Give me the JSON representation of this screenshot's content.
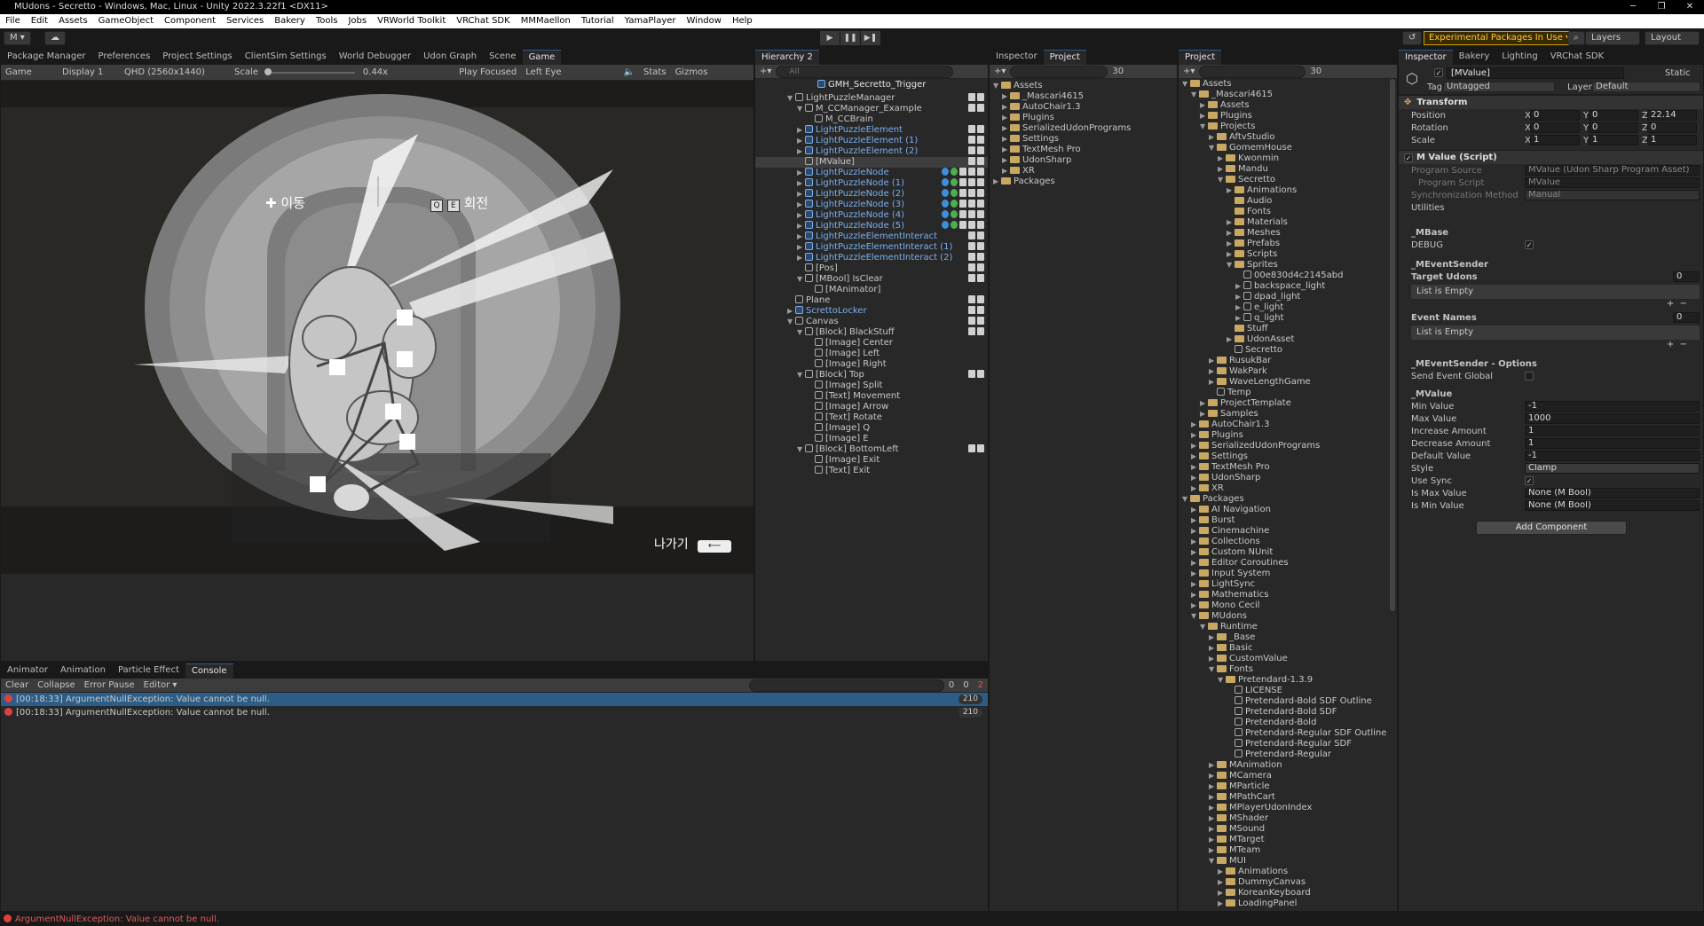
{
  "title": "MUdons - Secretto - Windows, Mac, Linux - Unity 2022.3.22f1 <DX11>",
  "menu": [
    "File",
    "Edit",
    "Assets",
    "GameObject",
    "Component",
    "Services",
    "Bakery",
    "Tools",
    "Jobs",
    "VRWorld Toolkit",
    "VRChat SDK",
    "MMMaellon",
    "Tutorial",
    "YamaPlayer",
    "Window",
    "Help"
  ],
  "toolbar": {
    "account": "M ▾",
    "experimental": "Experimental Packages In Use ▾",
    "layers": "Layers",
    "layout": "Layout"
  },
  "left_tabs": [
    "Package Manager",
    "Preferences",
    "Project Settings",
    "ClientSim Settings",
    "World Debugger",
    "Udon Graph",
    "Scene",
    "Game"
  ],
  "game_bar": {
    "mode": "Game",
    "display": "Display 1",
    "resolution": "QHD (2560x1440)",
    "scale_label": "Scale",
    "scale_value": "0.44x",
    "play_focused": "Play Focused",
    "eye": "Left Eye",
    "stats": "Stats",
    "gizmos": "Gizmos"
  },
  "game_ui": {
    "move_key": "✚",
    "move_label": "이동",
    "q": "Q",
    "e": "E",
    "rotate_label": "회전",
    "exit_label": "나가기",
    "exit_key": "⟵"
  },
  "hierarchy": {
    "tab": "Hierarchy 2",
    "search": "All",
    "scene": "GMH_Secretto_Trigger",
    "items": [
      {
        "d": 1,
        "t": "GMH_Secretto_Trigger",
        "b": false,
        "a": "▼",
        "s": false
      },
      {
        "d": 2,
        "t": "LightPuzzleManager",
        "b": false,
        "a": "▼",
        "s": false
      },
      {
        "d": 3,
        "t": "M_CCManager_Example",
        "b": false,
        "a": "▼",
        "s": false
      },
      {
        "d": 4,
        "t": "M_CCBrain",
        "b": false,
        "a": "",
        "s": false
      },
      {
        "d": 3,
        "t": "LightPuzzleElement",
        "b": true,
        "a": "▶",
        "s": false
      },
      {
        "d": 3,
        "t": "LightPuzzleElement (1)",
        "b": true,
        "a": "▶",
        "s": false
      },
      {
        "d": 3,
        "t": "LightPuzzleElement (2)",
        "b": true,
        "a": "▶",
        "s": false
      },
      {
        "d": 3,
        "t": "[MValue]",
        "b": false,
        "a": "",
        "s": true
      },
      {
        "d": 3,
        "t": "LightPuzzleNode",
        "b": true,
        "a": "▶",
        "s": false
      },
      {
        "d": 3,
        "t": "LightPuzzleNode (1)",
        "b": true,
        "a": "▶",
        "s": false
      },
      {
        "d": 3,
        "t": "LightPuzzleNode (2)",
        "b": true,
        "a": "▶",
        "s": false
      },
      {
        "d": 3,
        "t": "LightPuzzleNode (3)",
        "b": true,
        "a": "▶",
        "s": false
      },
      {
        "d": 3,
        "t": "LightPuzzleNode (4)",
        "b": true,
        "a": "▶",
        "s": false
      },
      {
        "d": 3,
        "t": "LightPuzzleNode (5)",
        "b": true,
        "a": "▶",
        "s": false
      },
      {
        "d": 3,
        "t": "LightPuzzleElementInteract",
        "b": true,
        "a": "▶",
        "s": false
      },
      {
        "d": 3,
        "t": "LightPuzzleElementInteract (1)",
        "b": true,
        "a": "▶",
        "s": false
      },
      {
        "d": 3,
        "t": "LightPuzzleElementInteract (2)",
        "b": true,
        "a": "▶",
        "s": false
      },
      {
        "d": 3,
        "t": "[Pos]",
        "b": false,
        "a": "",
        "s": false
      },
      {
        "d": 3,
        "t": "[MBool] IsClear",
        "b": false,
        "a": "▼",
        "s": false
      },
      {
        "d": 4,
        "t": "[MAnimator]",
        "b": false,
        "a": "",
        "s": false
      },
      {
        "d": 2,
        "t": "Plane",
        "b": false,
        "a": "",
        "s": false
      },
      {
        "d": 2,
        "t": "ScrettoLocker",
        "b": true,
        "a": "▶",
        "s": false
      },
      {
        "d": 2,
        "t": "Canvas",
        "b": false,
        "a": "▼",
        "s": false
      },
      {
        "d": 3,
        "t": "[Block] BlackStuff",
        "b": false,
        "a": "▼",
        "s": false
      },
      {
        "d": 4,
        "t": "[Image] Center",
        "b": false,
        "a": "",
        "s": false
      },
      {
        "d": 4,
        "t": "[Image] Left",
        "b": false,
        "a": "",
        "s": false
      },
      {
        "d": 4,
        "t": "[Image] Right",
        "b": false,
        "a": "",
        "s": false
      },
      {
        "d": 3,
        "t": "[Block] Top",
        "b": false,
        "a": "▼",
        "s": false
      },
      {
        "d": 4,
        "t": "[Image] Split",
        "b": false,
        "a": "",
        "s": false
      },
      {
        "d": 4,
        "t": "[Text] Movement",
        "b": false,
        "a": "",
        "s": false
      },
      {
        "d": 4,
        "t": "[Image] Arrow",
        "b": false,
        "a": "",
        "s": false
      },
      {
        "d": 4,
        "t": "[Text] Rotate",
        "b": false,
        "a": "",
        "s": false
      },
      {
        "d": 4,
        "t": "[Image] Q",
        "b": false,
        "a": "",
        "s": false
      },
      {
        "d": 4,
        "t": "[Image] E",
        "b": false,
        "a": "",
        "s": false
      },
      {
        "d": 3,
        "t": "[Block] BottomLeft",
        "b": false,
        "a": "▼",
        "s": false
      },
      {
        "d": 4,
        "t": "[Image] Exit",
        "b": false,
        "a": "",
        "s": false
      },
      {
        "d": 4,
        "t": "[Text] Exit",
        "b": false,
        "a": "",
        "s": false
      }
    ]
  },
  "project_small": {
    "tabs": [
      "Inspector",
      "Project"
    ],
    "count": "30",
    "items": [
      {
        "d": 0,
        "t": "Assets",
        "a": "▼"
      },
      {
        "d": 1,
        "t": "_Mascari4615",
        "a": "▶"
      },
      {
        "d": 1,
        "t": "AutoChair1.3",
        "a": "▶"
      },
      {
        "d": 1,
        "t": "Plugins",
        "a": "▶"
      },
      {
        "d": 1,
        "t": "SerializedUdonPrograms",
        "a": "▶"
      },
      {
        "d": 1,
        "t": "Settings",
        "a": "▶"
      },
      {
        "d": 1,
        "t": "TextMesh Pro",
        "a": "▶"
      },
      {
        "d": 1,
        "t": "UdonSharp",
        "a": "▶"
      },
      {
        "d": 1,
        "t": "XR",
        "a": "▶"
      },
      {
        "d": 0,
        "t": "Packages",
        "a": "▶"
      }
    ]
  },
  "project": {
    "tab": "Project",
    "count": "30",
    "items": [
      {
        "d": 0,
        "t": "Assets",
        "a": "▼",
        "f": 1
      },
      {
        "d": 1,
        "t": "_Mascari4615",
        "a": "▼",
        "f": 1
      },
      {
        "d": 2,
        "t": "Assets",
        "a": "▶",
        "f": 1
      },
      {
        "d": 2,
        "t": "Plugins",
        "a": "▶",
        "f": 1
      },
      {
        "d": 2,
        "t": "Projects",
        "a": "▼",
        "f": 1
      },
      {
        "d": 3,
        "t": "AftvStudio",
        "a": "▶",
        "f": 1
      },
      {
        "d": 3,
        "t": "GomemHouse",
        "a": "▼",
        "f": 1
      },
      {
        "d": 4,
        "t": "Kwonmin",
        "a": "▶",
        "f": 1
      },
      {
        "d": 4,
        "t": "Mandu",
        "a": "▶",
        "f": 1
      },
      {
        "d": 4,
        "t": "Secretto",
        "a": "▼",
        "f": 1
      },
      {
        "d": 5,
        "t": "Animations",
        "a": "▶",
        "f": 1
      },
      {
        "d": 5,
        "t": "Audio",
        "a": "",
        "f": 1
      },
      {
        "d": 5,
        "t": "Fonts",
        "a": "",
        "f": 1
      },
      {
        "d": 5,
        "t": "Materials",
        "a": "▶",
        "f": 1
      },
      {
        "d": 5,
        "t": "Meshes",
        "a": "▶",
        "f": 1
      },
      {
        "d": 5,
        "t": "Prefabs",
        "a": "▶",
        "f": 1
      },
      {
        "d": 5,
        "t": "Scripts",
        "a": "▶",
        "f": 1
      },
      {
        "d": 5,
        "t": "Sprites",
        "a": "▼",
        "f": 1
      },
      {
        "d": 6,
        "t": "00e830d4c2145abd",
        "a": "",
        "f": 0
      },
      {
        "d": 6,
        "t": "backspace_light",
        "a": "▶",
        "f": 0
      },
      {
        "d": 6,
        "t": "dpad_light",
        "a": "▶",
        "f": 0
      },
      {
        "d": 6,
        "t": "e_light",
        "a": "▶",
        "f": 0
      },
      {
        "d": 6,
        "t": "q_light",
        "a": "▶",
        "f": 0
      },
      {
        "d": 5,
        "t": "Stuff",
        "a": "",
        "f": 1
      },
      {
        "d": 5,
        "t": "UdonAsset",
        "a": "▶",
        "f": 1
      },
      {
        "d": 5,
        "t": "Secretto",
        "a": "",
        "f": 0
      },
      {
        "d": 3,
        "t": "RusukBar",
        "a": "▶",
        "f": 1
      },
      {
        "d": 3,
        "t": "WakPark",
        "a": "▶",
        "f": 1
      },
      {
        "d": 3,
        "t": "WaveLengthGame",
        "a": "▶",
        "f": 1
      },
      {
        "d": 3,
        "t": "Temp",
        "a": "",
        "f": 0
      },
      {
        "d": 2,
        "t": "ProjectTemplate",
        "a": "▶",
        "f": 1
      },
      {
        "d": 2,
        "t": "Samples",
        "a": "▶",
        "f": 1
      },
      {
        "d": 1,
        "t": "AutoChair1.3",
        "a": "▶",
        "f": 1
      },
      {
        "d": 1,
        "t": "Plugins",
        "a": "▶",
        "f": 1
      },
      {
        "d": 1,
        "t": "SerializedUdonPrograms",
        "a": "▶",
        "f": 1
      },
      {
        "d": 1,
        "t": "Settings",
        "a": "▶",
        "f": 1
      },
      {
        "d": 1,
        "t": "TextMesh Pro",
        "a": "▶",
        "f": 1
      },
      {
        "d": 1,
        "t": "UdonSharp",
        "a": "▶",
        "f": 1
      },
      {
        "d": 1,
        "t": "XR",
        "a": "▶",
        "f": 1
      },
      {
        "d": 0,
        "t": "Packages",
        "a": "▼",
        "f": 1
      },
      {
        "d": 1,
        "t": "AI Navigation",
        "a": "▶",
        "f": 1
      },
      {
        "d": 1,
        "t": "Burst",
        "a": "▶",
        "f": 1
      },
      {
        "d": 1,
        "t": "Cinemachine",
        "a": "▶",
        "f": 1
      },
      {
        "d": 1,
        "t": "Collections",
        "a": "▶",
        "f": 1
      },
      {
        "d": 1,
        "t": "Custom NUnit",
        "a": "▶",
        "f": 1
      },
      {
        "d": 1,
        "t": "Editor Coroutines",
        "a": "▶",
        "f": 1
      },
      {
        "d": 1,
        "t": "Input System",
        "a": "▶",
        "f": 1
      },
      {
        "d": 1,
        "t": "LightSync",
        "a": "▶",
        "f": 1
      },
      {
        "d": 1,
        "t": "Mathematics",
        "a": "▶",
        "f": 1
      },
      {
        "d": 1,
        "t": "Mono Cecil",
        "a": "▶",
        "f": 1
      },
      {
        "d": 1,
        "t": "MUdons",
        "a": "▼",
        "f": 1
      },
      {
        "d": 2,
        "t": "Runtime",
        "a": "▼",
        "f": 1
      },
      {
        "d": 3,
        "t": "_Base",
        "a": "▶",
        "f": 1
      },
      {
        "d": 3,
        "t": "Basic",
        "a": "▶",
        "f": 1
      },
      {
        "d": 3,
        "t": "CustomValue",
        "a": "▶",
        "f": 1
      },
      {
        "d": 3,
        "t": "Fonts",
        "a": "▼",
        "f": 1
      },
      {
        "d": 4,
        "t": "Pretendard-1.3.9",
        "a": "▼",
        "f": 1
      },
      {
        "d": 5,
        "t": "LICENSE",
        "a": "",
        "f": 0
      },
      {
        "d": 5,
        "t": "Pretendard-Bold SDF Outline",
        "a": "",
        "f": 0
      },
      {
        "d": 5,
        "t": "Pretendard-Bold SDF",
        "a": "",
        "f": 0
      },
      {
        "d": 5,
        "t": "Pretendard-Bold",
        "a": "",
        "f": 0
      },
      {
        "d": 5,
        "t": "Pretendard-Regular SDF Outline",
        "a": "",
        "f": 0
      },
      {
        "d": 5,
        "t": "Pretendard-Regular SDF",
        "a": "",
        "f": 0
      },
      {
        "d": 5,
        "t": "Pretendard-Regular",
        "a": "",
        "f": 0
      },
      {
        "d": 3,
        "t": "MAnimation",
        "a": "▶",
        "f": 1
      },
      {
        "d": 3,
        "t": "MCamera",
        "a": "▶",
        "f": 1
      },
      {
        "d": 3,
        "t": "MParticle",
        "a": "▶",
        "f": 1
      },
      {
        "d": 3,
        "t": "MPathCart",
        "a": "▶",
        "f": 1
      },
      {
        "d": 3,
        "t": "MPlayerUdonIndex",
        "a": "▶",
        "f": 1
      },
      {
        "d": 3,
        "t": "MShader",
        "a": "▶",
        "f": 1
      },
      {
        "d": 3,
        "t": "MSound",
        "a": "▶",
        "f": 1
      },
      {
        "d": 3,
        "t": "MTarget",
        "a": "▶",
        "f": 1
      },
      {
        "d": 3,
        "t": "MTeam",
        "a": "▶",
        "f": 1
      },
      {
        "d": 3,
        "t": "MUI",
        "a": "▼",
        "f": 1
      },
      {
        "d": 4,
        "t": "Animations",
        "a": "▶",
        "f": 1
      },
      {
        "d": 4,
        "t": "DummyCanvas",
        "a": "▶",
        "f": 1
      },
      {
        "d": 4,
        "t": "KoreanKeyboard",
        "a": "▶",
        "f": 1
      },
      {
        "d": 4,
        "t": "LoadingPanel",
        "a": "▶",
        "f": 1
      }
    ]
  },
  "inspector": {
    "tabs": [
      "Inspector",
      "Bakery",
      "Lighting",
      "VRChat SDK"
    ],
    "object_name": "[MValue]",
    "static": "Static",
    "tag_label": "Tag",
    "tag": "Untagged",
    "layer_label": "Layer",
    "layer": "Default",
    "transform": {
      "title": "Transform",
      "position_label": "Position",
      "rotation_label": "Rotation",
      "scale_label": "Scale",
      "position": [
        "0",
        "0",
        "22.14"
      ],
      "rotation": [
        "0",
        "0",
        "0"
      ],
      "scale": [
        "1",
        "1",
        "1"
      ]
    },
    "script_title": "M Value (Script)",
    "program_source_label": "Program Source",
    "program_source": "MValue (Udon Sharp Program Asset)",
    "program_script_label": "Program Script",
    "program_script": "MValue",
    "sync_label": "Synchronization Method",
    "sync": "Manual",
    "utilities": "Utilities",
    "mbase": "_MBase",
    "debug_label": "DEBUG",
    "meventsender": "_MEventSender",
    "target_udons": "Target Udons",
    "target_udons_count": "0",
    "list_empty": "List is Empty",
    "event_names": "Event Names",
    "event_names_count": "0",
    "options": "_MEventSender - Options",
    "send_global": "Send Event Global",
    "mvalue": "_MValue",
    "fields": [
      {
        "l": "Min Value",
        "v": "-1"
      },
      {
        "l": "Max Value",
        "v": "1000"
      },
      {
        "l": "Increase Amount",
        "v": "1"
      },
      {
        "l": "Decrease Amount",
        "v": "1"
      },
      {
        "l": "Default Value",
        "v": "-1"
      },
      {
        "l": "Style",
        "v": "Clamp"
      }
    ],
    "use_sync": "Use Sync",
    "is_max_label": "Is Max Value",
    "is_max": "None (M Bool)",
    "is_min_label": "Is Min Value",
    "is_min": "None (M Bool)",
    "add_component": "Add Component"
  },
  "console": {
    "tabs": [
      "Animator",
      "Animation",
      "Particle Effect",
      "Console"
    ],
    "clear": "Clear",
    "collapse": "Collapse",
    "error_pause": "Error Pause",
    "editor": "Editor ▾",
    "counts": [
      "0",
      "0",
      "2"
    ],
    "rows": [
      {
        "msg": "[00:18:33] ArgumentNullException: Value cannot be null.",
        "count": "210"
      },
      {
        "msg": "[00:18:33] ArgumentNullException: Value cannot be null.",
        "count": "210"
      }
    ]
  },
  "status": "ArgumentNullException: Value cannot be null."
}
